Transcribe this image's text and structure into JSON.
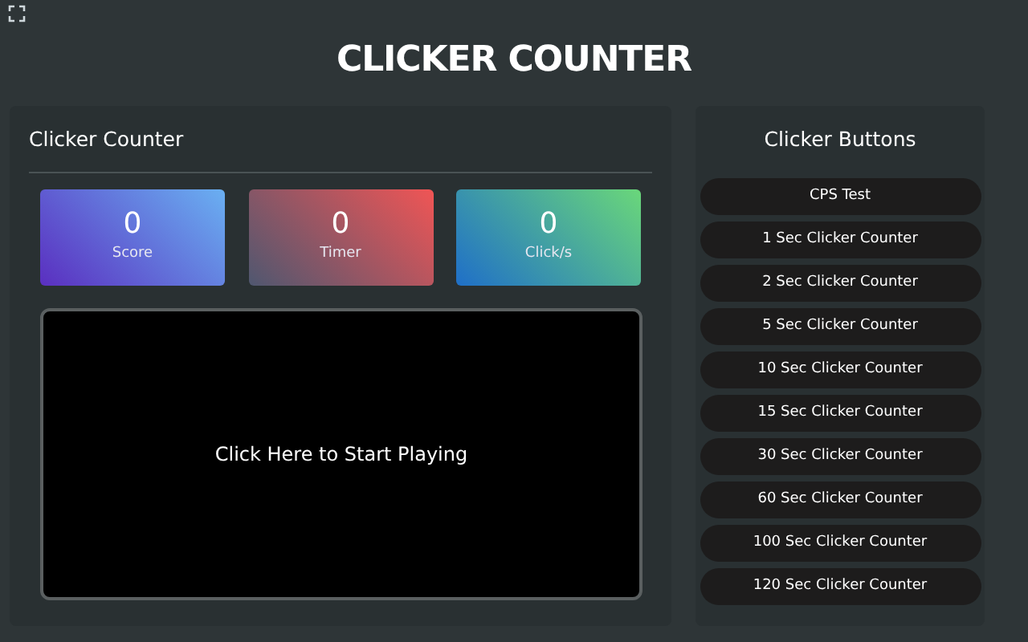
{
  "title": "CLICKER COUNTER",
  "counter_panel": {
    "heading": "Clicker Counter",
    "stats": [
      {
        "kind": "score",
        "value": "0",
        "label": "Score"
      },
      {
        "kind": "timer",
        "value": "0",
        "label": "Timer"
      },
      {
        "kind": "rate",
        "value": "0",
        "label": "Click/s"
      }
    ],
    "play_area": "Click Here to Start Playing"
  },
  "buttons_panel": {
    "heading": "Clicker Buttons",
    "buttons": [
      "CPS Test",
      "1 Sec Clicker Counter",
      "2 Sec Clicker Counter",
      "5 Sec Clicker Counter",
      "10 Sec Clicker Counter",
      "15 Sec Clicker Counter",
      "30 Sec Clicker Counter",
      "60 Sec Clicker Counter",
      "100 Sec Clicker Counter",
      "120 Sec Clicker Counter"
    ]
  }
}
